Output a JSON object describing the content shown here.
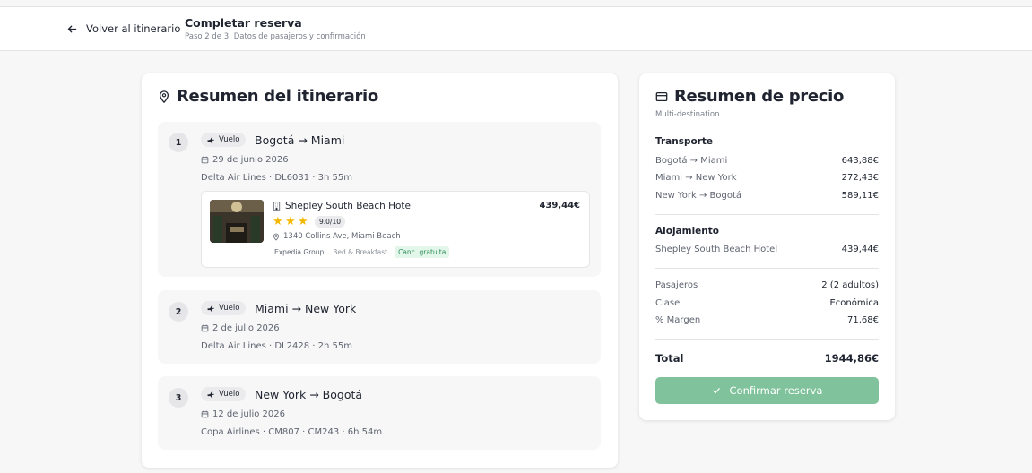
{
  "header": {
    "back_label": "Volver al itinerario",
    "title": "Completar reserva",
    "subtitle": "Paso 2 de 3: Datos de pasajeros y confirmación"
  },
  "itinerary": {
    "title": "Resumen del itinerario",
    "segments": [
      {
        "number": "1",
        "type": "Vuelo",
        "route": "Bogotá → Miami",
        "date": "29 de junio 2026",
        "airline": "Delta Air Lines · DL6031 · 3h 55m"
      },
      {
        "number": "2",
        "type": "Vuelo",
        "route": "Miami → New York",
        "date": "2 de julio 2026",
        "airline": "Delta Air Lines · DL2428 · 2h 55m"
      },
      {
        "number": "3",
        "type": "Vuelo",
        "route": "New York → Bogotá",
        "date": "12 de julio 2026",
        "airline": "Copa Airlines · CM807 · CM243 · 6h 54m"
      }
    ],
    "hotel": {
      "name": "Shepley South Beach Hotel",
      "price": "439,44€",
      "stars": 3,
      "rating": "9.0/10",
      "address": "1340 Collins Ave, Miami Beach",
      "tags": [
        "Expedia Group",
        "Bed & Breakfast",
        "Canc. gratuita"
      ]
    }
  },
  "price": {
    "title": "Resumen de precio",
    "subtitle": "Multi-destination",
    "transport_title": "Transporte",
    "transport": [
      {
        "label": "Bogotá → Miami",
        "value": "643,88€"
      },
      {
        "label": "Miami → New York",
        "value": "272,43€"
      },
      {
        "label": "New York → Bogotá",
        "value": "589,11€"
      }
    ],
    "lodging_title": "Alojamiento",
    "lodging": [
      {
        "label": "Shepley South Beach Hotel",
        "value": "439,44€"
      }
    ],
    "details": [
      {
        "label": "Pasajeros",
        "value": "2 (2 adultos)"
      },
      {
        "label": "Clase",
        "value": "Económica"
      },
      {
        "label": "% Margen",
        "value": "71,68€"
      }
    ],
    "total_label": "Total",
    "total_value": "1944,86€",
    "confirm_label": "Confirmar reserva"
  },
  "colors": {
    "accent_green": "#7fc29b",
    "star": "#f5b800",
    "tag_green_bg": "#e2f6ea"
  }
}
